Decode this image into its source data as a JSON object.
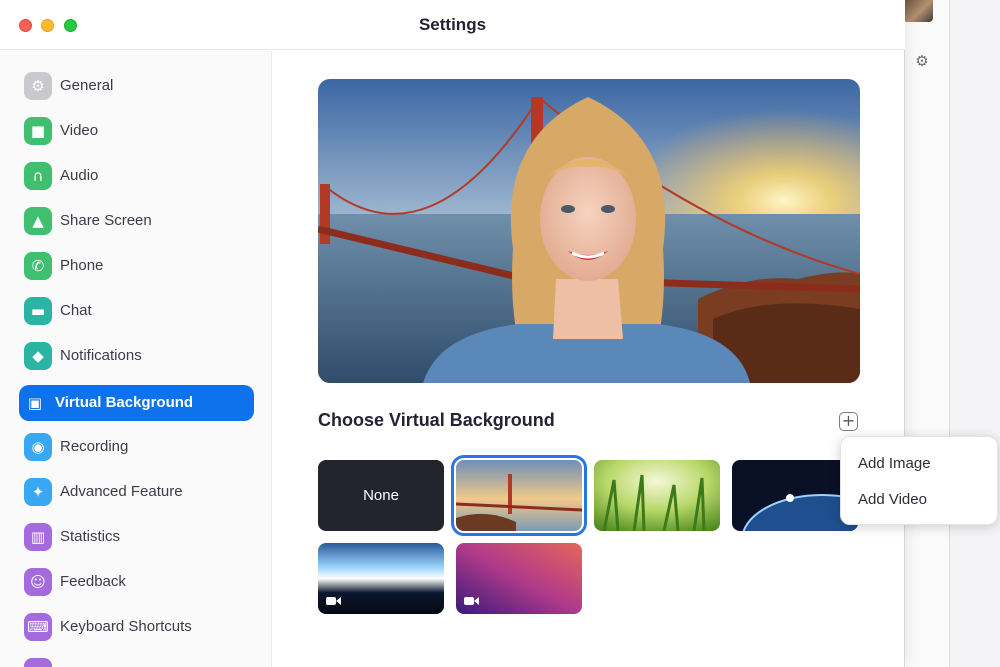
{
  "window": {
    "title": "Settings"
  },
  "sidebar": {
    "items": [
      {
        "label": "General",
        "icon": "gear-icon",
        "color": "#c9c9cd",
        "glyph": "⚙"
      },
      {
        "label": "Video",
        "icon": "video-camera-icon",
        "color": "#3fbf6f",
        "glyph": "■"
      },
      {
        "label": "Audio",
        "icon": "headphones-icon",
        "color": "#3fbf6f",
        "glyph": "∩"
      },
      {
        "label": "Share Screen",
        "icon": "share-screen-icon",
        "color": "#3fbf6f",
        "glyph": "▲"
      },
      {
        "label": "Phone",
        "icon": "phone-icon",
        "color": "#3fbf6f",
        "glyph": "✆"
      },
      {
        "label": "Chat",
        "icon": "chat-bubble-icon",
        "color": "#2bb3a3",
        "glyph": "▬"
      },
      {
        "label": "Notifications",
        "icon": "bell-icon",
        "color": "#2bb3a3",
        "glyph": "◆"
      },
      {
        "label": "Virtual Background",
        "icon": "person-portrait-icon",
        "color": "#0e72ed",
        "glyph": "▣",
        "active": true
      },
      {
        "label": "Recording",
        "icon": "record-icon",
        "color": "#3aa7f3",
        "glyph": "◉"
      },
      {
        "label": "Advanced Feature",
        "icon": "sparkle-icon",
        "color": "#3aa7f3",
        "glyph": "✦"
      },
      {
        "label": "Statistics",
        "icon": "bar-chart-icon",
        "color": "#a66adf",
        "glyph": "▥"
      },
      {
        "label": "Feedback",
        "icon": "smiley-icon",
        "color": "#a66adf",
        "glyph": "☺"
      },
      {
        "label": "Keyboard Shortcuts",
        "icon": "keyboard-icon",
        "color": "#a66adf",
        "glyph": "⌨"
      },
      {
        "label": "",
        "icon": "accessibility-icon",
        "color": "#a66adf",
        "glyph": ""
      }
    ]
  },
  "main": {
    "section_title": "Choose Virtual Background",
    "add_button_glyph": "+",
    "thumbnails": [
      {
        "name": "none",
        "label": "None"
      },
      {
        "name": "golden-gate",
        "label": ""
      },
      {
        "name": "grass",
        "label": ""
      },
      {
        "name": "earth-space",
        "label": ""
      },
      {
        "name": "earth-aurora-video",
        "label": ""
      },
      {
        "name": "purple-gradient-video",
        "label": ""
      }
    ]
  },
  "dropdown": {
    "items": [
      {
        "label": "Add Image"
      },
      {
        "label": "Add Video"
      }
    ]
  },
  "colors": {
    "accent": "#0e72ed",
    "selected_outline": "#2b74e6"
  }
}
